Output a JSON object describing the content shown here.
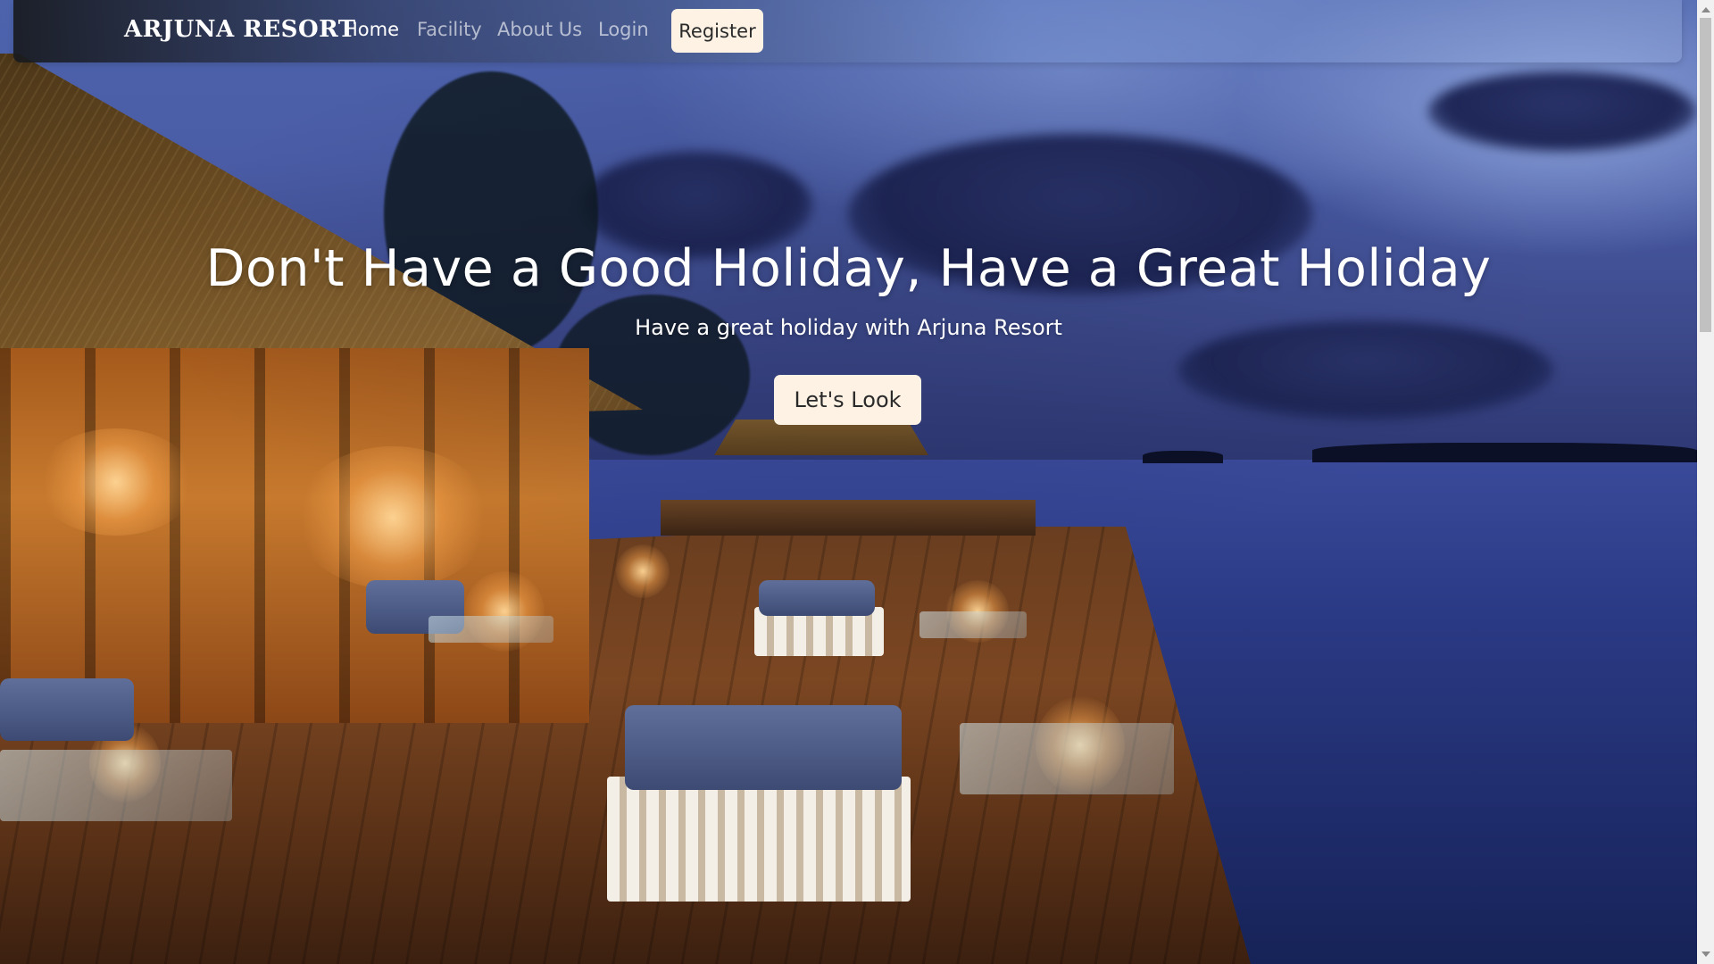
{
  "navbar": {
    "brand": "ARJUNA RESORT",
    "links": [
      {
        "label": "Home",
        "active": true
      },
      {
        "label": "Facility",
        "active": false
      },
      {
        "label": "About Us",
        "active": false
      },
      {
        "label": "Login",
        "active": false
      }
    ],
    "register_label": "Register"
  },
  "hero": {
    "title": "Don't Have a Good Holiday, Have a Great Holiday",
    "subtitle": "Have a great holiday with Arjuna Resort",
    "button_label": "Let's Look"
  },
  "colors": {
    "button_bg": "#fdf2e4",
    "nav_active": "#ffffff",
    "nav_inactive": "rgba(255,255,255,0.62)"
  }
}
